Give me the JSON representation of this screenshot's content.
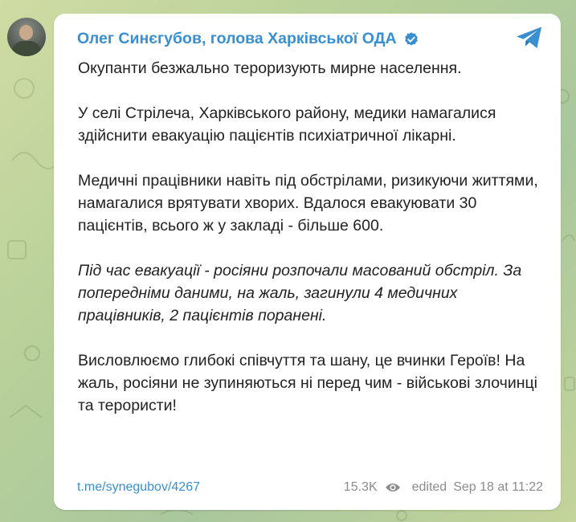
{
  "channel": {
    "name": "Олег Синєгубов, голова Харківської ОДА",
    "verified": true,
    "accent_color": "#3a8fd0"
  },
  "post": {
    "paragraphs": [
      {
        "text": "Окупанти безжально тероризують мирне населення.",
        "italic": false
      },
      {
        "text": "У селі Стрілеча, Харківського району, медики намагалися здійснити евакуацію пацієнтів психіатричної лікарні.",
        "italic": false
      },
      {
        "text": "Медичні працівники навіть під обстрілами, ризикуючи життями, намагалися врятувати хворих. Вдалося евакуювати 30 пацієнтів, всього ж у закладі - більше 600.",
        "italic": false
      },
      {
        "text": "Під час евакуації - росіяни розпочали масований обстріл. За попередніми даними, на жаль, загинули 4 медичних працівників, 2 пацієнтів поранені.",
        "italic": true
      },
      {
        "text": "Висловлюємо глибокі співчуття та шану, це вчинки Героїв! На жаль, росіяни не зупиняються ні перед чим - військові злочинці та терористи!",
        "italic": false
      }
    ]
  },
  "footer": {
    "link": "t.me/synegubov/4267",
    "views": "15.3K",
    "edited_label": "edited",
    "timestamp": "Sep 18 at 11:22"
  },
  "icons": {
    "telegram": "telegram-icon",
    "verified": "verified-badge-icon",
    "views": "eye-icon"
  }
}
